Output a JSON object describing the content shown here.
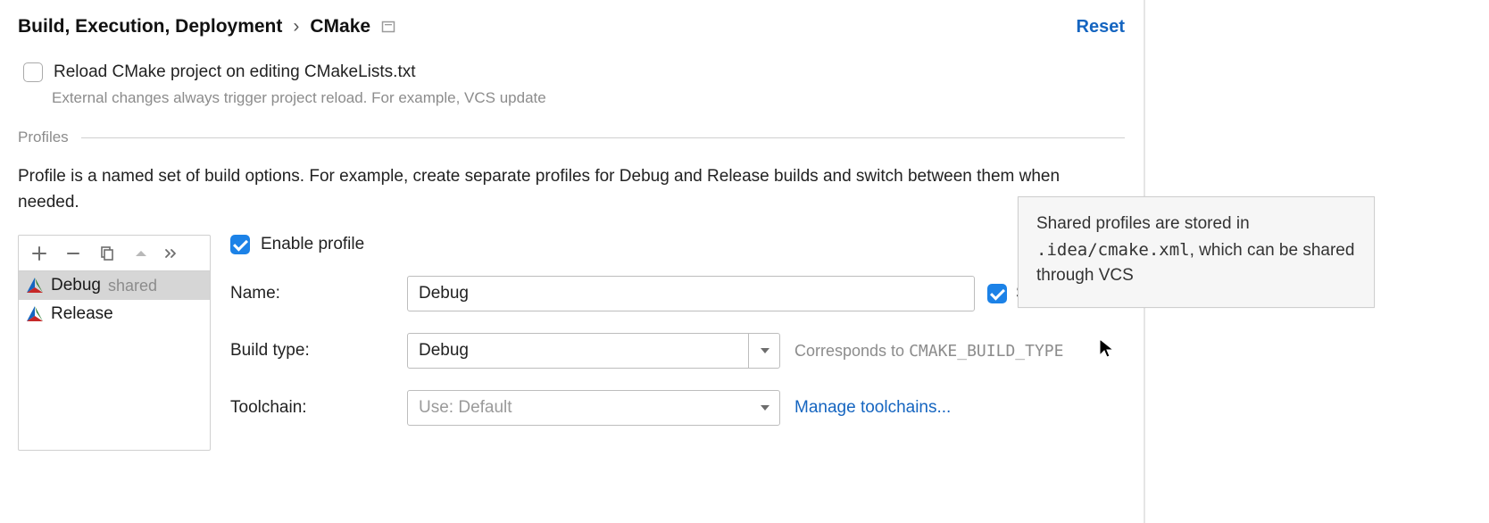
{
  "breadcrumb": {
    "parent": "Build, Execution, Deployment",
    "separator": "›",
    "current": "CMake"
  },
  "reset_label": "Reset",
  "reload_checkbox": {
    "label": "Reload CMake project on editing CMakeLists.txt",
    "hint": "External changes always trigger project reload. For example, VCS update"
  },
  "profiles_section": {
    "title": "Profiles",
    "description": "Profile is a named set of build options. For example, create separate profiles for Debug and Release builds and switch between them when needed."
  },
  "profile_list": [
    {
      "name": "Debug",
      "shared": true
    },
    {
      "name": "Release",
      "shared": false
    }
  ],
  "shared_tag": "shared",
  "enable_profile_label": "Enable profile",
  "form": {
    "name_label": "Name:",
    "name_value": "Debug",
    "share_label": "Share",
    "build_type_label": "Build type:",
    "build_type_value": "Debug",
    "build_type_hint_prefix": "Corresponds to ",
    "build_type_hint_code": "CMAKE_BUILD_TYPE",
    "toolchain_label": "Toolchain:",
    "toolchain_placeholder": "Use: Default",
    "manage_toolchains": "Manage toolchains..."
  },
  "tooltip": {
    "line_pre": "Shared profiles are stored in ",
    "line_code": ".idea/cmake.xml",
    "line_post": ", which can be shared through VCS"
  }
}
